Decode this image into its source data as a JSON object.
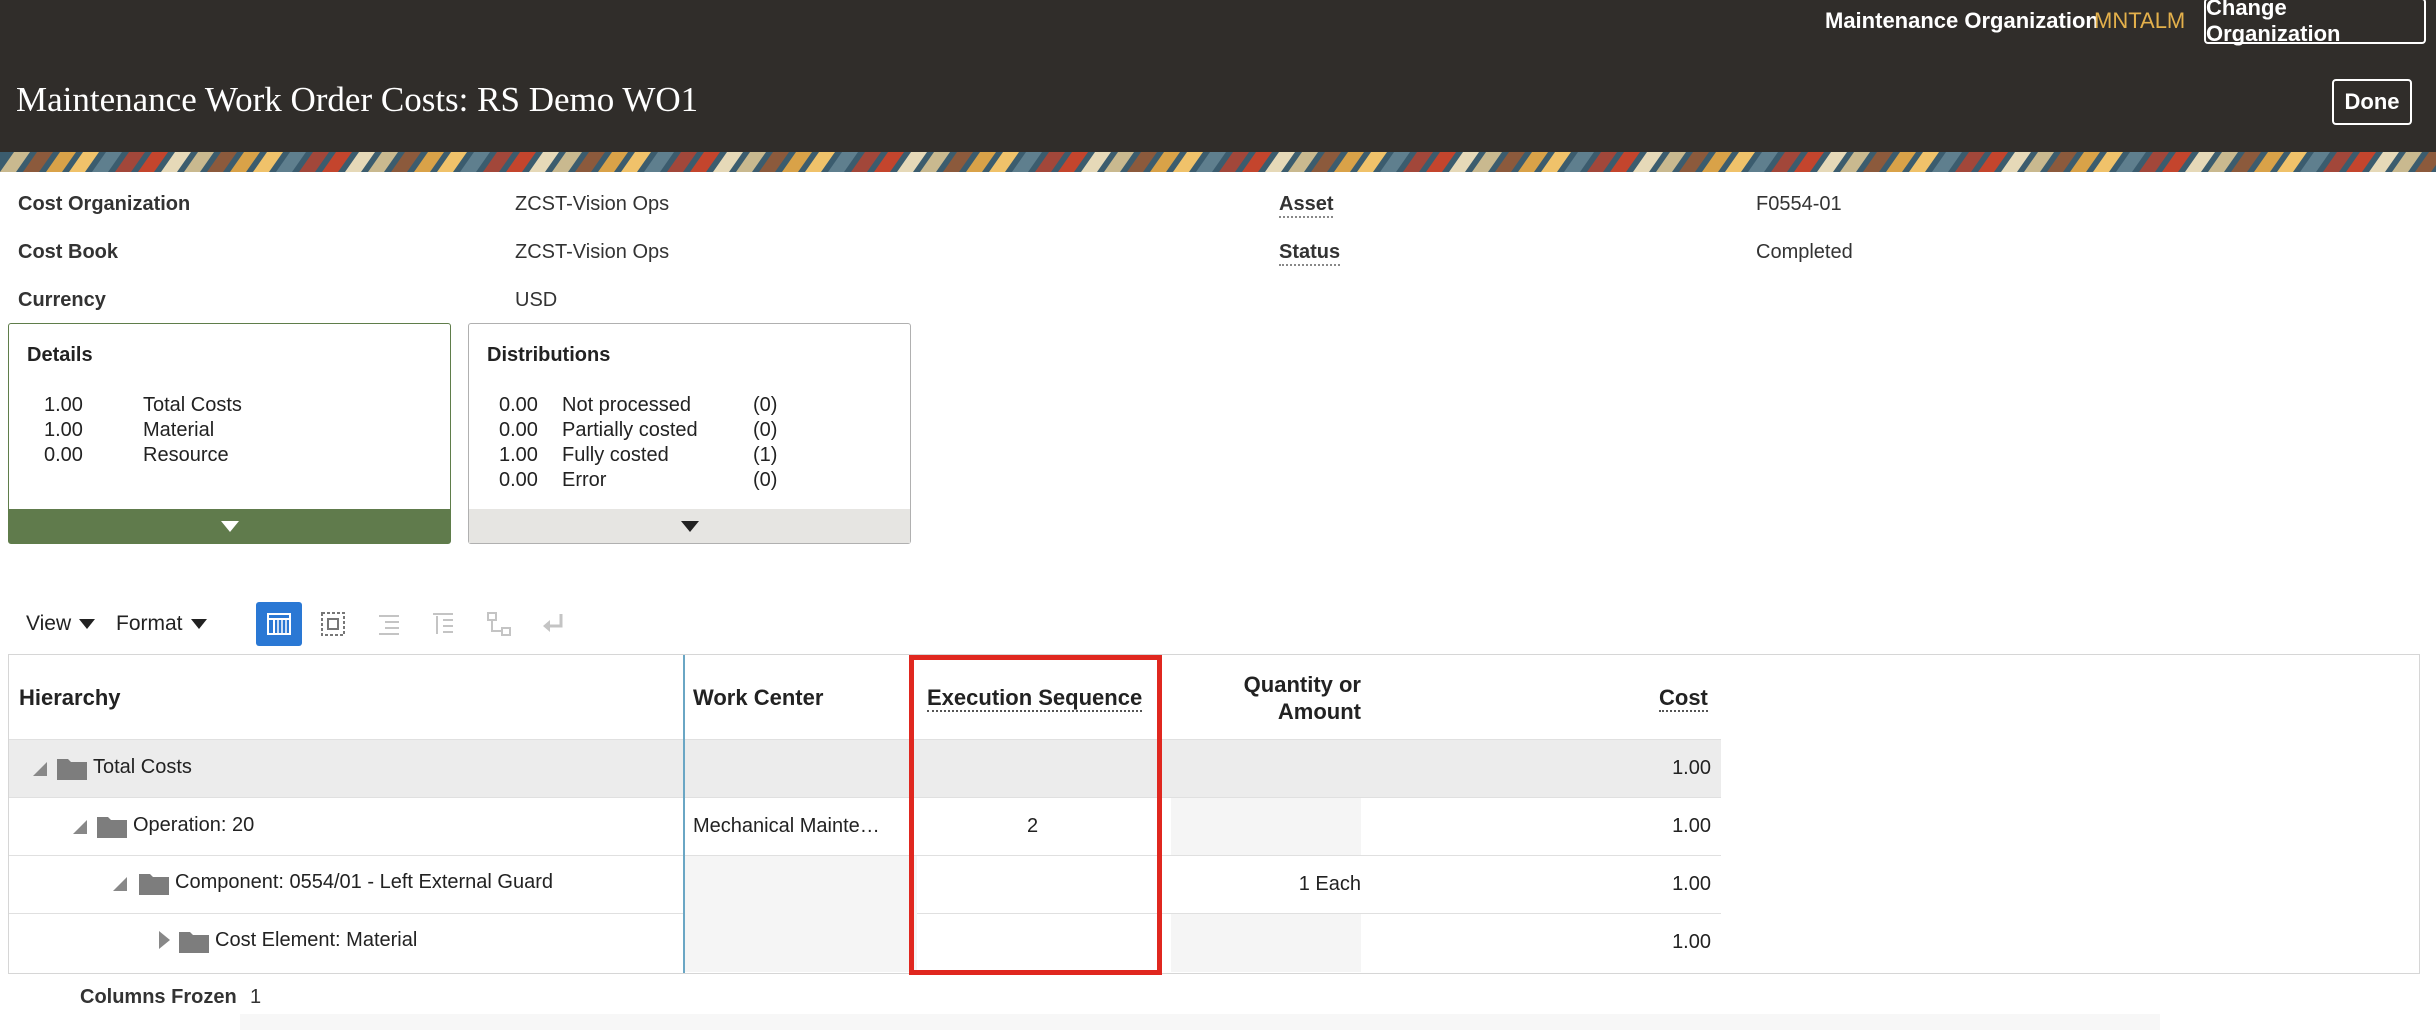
{
  "header": {
    "org_label": "Maintenance Organization",
    "org_code": "MNTALM",
    "change_org_label": "Change Organization",
    "title": "Maintenance Work Order Costs: RS Demo WO1",
    "done_label": "Done"
  },
  "info": {
    "cost_org_label": "Cost Organization",
    "cost_org_value": "ZCST-Vision Ops",
    "cost_book_label": "Cost Book",
    "cost_book_value": "ZCST-Vision Ops",
    "currency_label": "Currency",
    "currency_value": "USD",
    "asset_label": "Asset",
    "asset_value": "F0554-01",
    "status_label": "Status",
    "status_value": "Completed"
  },
  "details": {
    "title": "Details",
    "rows": [
      {
        "value": "1.00",
        "label": "Total Costs"
      },
      {
        "value": "1.00",
        "label": "Material"
      },
      {
        "value": "0.00",
        "label": "Resource"
      }
    ]
  },
  "distributions": {
    "title": "Distributions",
    "rows": [
      {
        "value": "0.00",
        "label": "Not processed",
        "count": "(0)"
      },
      {
        "value": "0.00",
        "label": "Partially costed",
        "count": "(0)"
      },
      {
        "value": "1.00",
        "label": "Fully costed",
        "count": "(1)"
      },
      {
        "value": "0.00",
        "label": "Error",
        "count": "(0)"
      }
    ]
  },
  "toolbar": {
    "view_label": "View",
    "format_label": "Format"
  },
  "table": {
    "headers": {
      "hierarchy": "Hierarchy",
      "work_center": "Work Center",
      "execution_sequence": "Execution Sequence",
      "quantity_line1": "Quantity or",
      "quantity_line2": "Amount",
      "cost": "Cost"
    },
    "rows": [
      {
        "hierarchy": "Total Costs",
        "work_center": "",
        "execution_sequence": "",
        "quantity": "",
        "cost": "1.00"
      },
      {
        "hierarchy": "Operation: 20",
        "work_center": "Mechanical Mainte…",
        "execution_sequence": "2",
        "quantity": "",
        "cost": "1.00"
      },
      {
        "hierarchy": "Component: 0554/01 - Left External Guard",
        "work_center": "",
        "execution_sequence": "",
        "quantity": "1 Each",
        "cost": "1.00"
      },
      {
        "hierarchy": "Cost Element: Material",
        "work_center": "",
        "execution_sequence": "",
        "quantity": "",
        "cost": "1.00"
      }
    ]
  },
  "footer": {
    "columns_frozen_label": "Columns Frozen",
    "columns_frozen_value": "1"
  },
  "colors": {
    "header_bg": "#302d2a",
    "org_code": "#e3b04b",
    "details_accent": "#607b4c",
    "active_tool": "#2a78d4",
    "highlight": "#e0271f"
  }
}
